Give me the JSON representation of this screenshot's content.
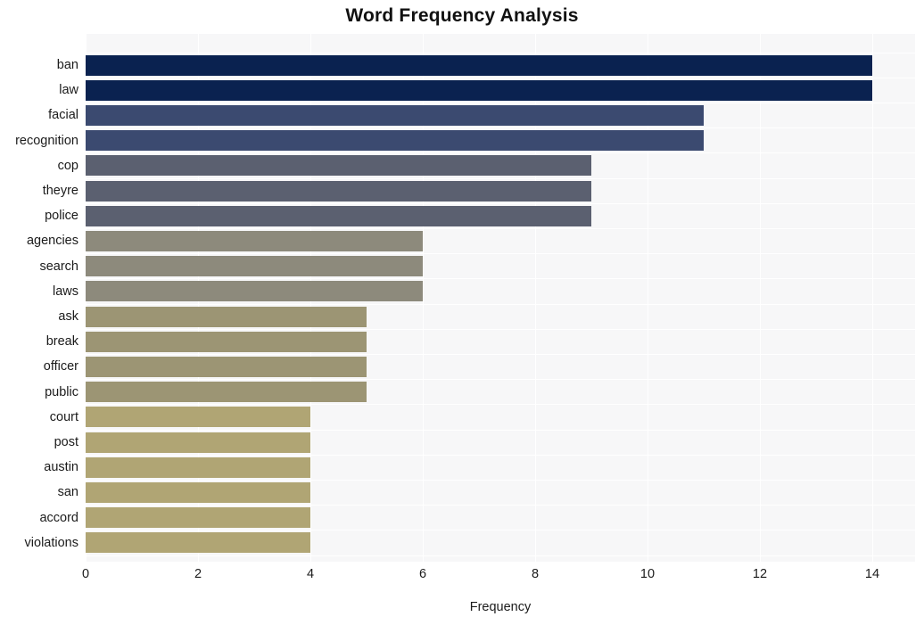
{
  "chart_data": {
    "type": "bar",
    "orientation": "horizontal",
    "title": "Word Frequency Analysis",
    "xlabel": "Frequency",
    "ylabel": "",
    "xlim": [
      0,
      14.8
    ],
    "xticks": [
      0,
      2,
      4,
      6,
      8,
      10,
      12,
      14
    ],
    "xticklabels": [
      "0",
      "2",
      "4",
      "6",
      "8",
      "10",
      "12",
      "14"
    ],
    "grid": true,
    "legend": null,
    "categories": [
      "ban",
      "law",
      "facial",
      "recognition",
      "cop",
      "theyre",
      "police",
      "agencies",
      "search",
      "laws",
      "ask",
      "break",
      "officer",
      "public",
      "court",
      "post",
      "austin",
      "san",
      "accord",
      "violations"
    ],
    "values": [
      14,
      14,
      11,
      11,
      9,
      9,
      9,
      6,
      6,
      6,
      5,
      5,
      5,
      5,
      4,
      4,
      4,
      4,
      4,
      4
    ],
    "bar_colors": [
      "#0a2250",
      "#0a2250",
      "#3b4a70",
      "#3b4a70",
      "#5b6070",
      "#5b6070",
      "#5b6070",
      "#8d8a7c",
      "#8d8a7c",
      "#8d8a7c",
      "#9c9574",
      "#9c9574",
      "#9c9574",
      "#9c9574",
      "#b0a574",
      "#b0a574",
      "#b0a574",
      "#b0a574",
      "#b0a574",
      "#b0a574"
    ],
    "plot_background": "#f7f7f8",
    "gridline_color": "#ffffff"
  }
}
